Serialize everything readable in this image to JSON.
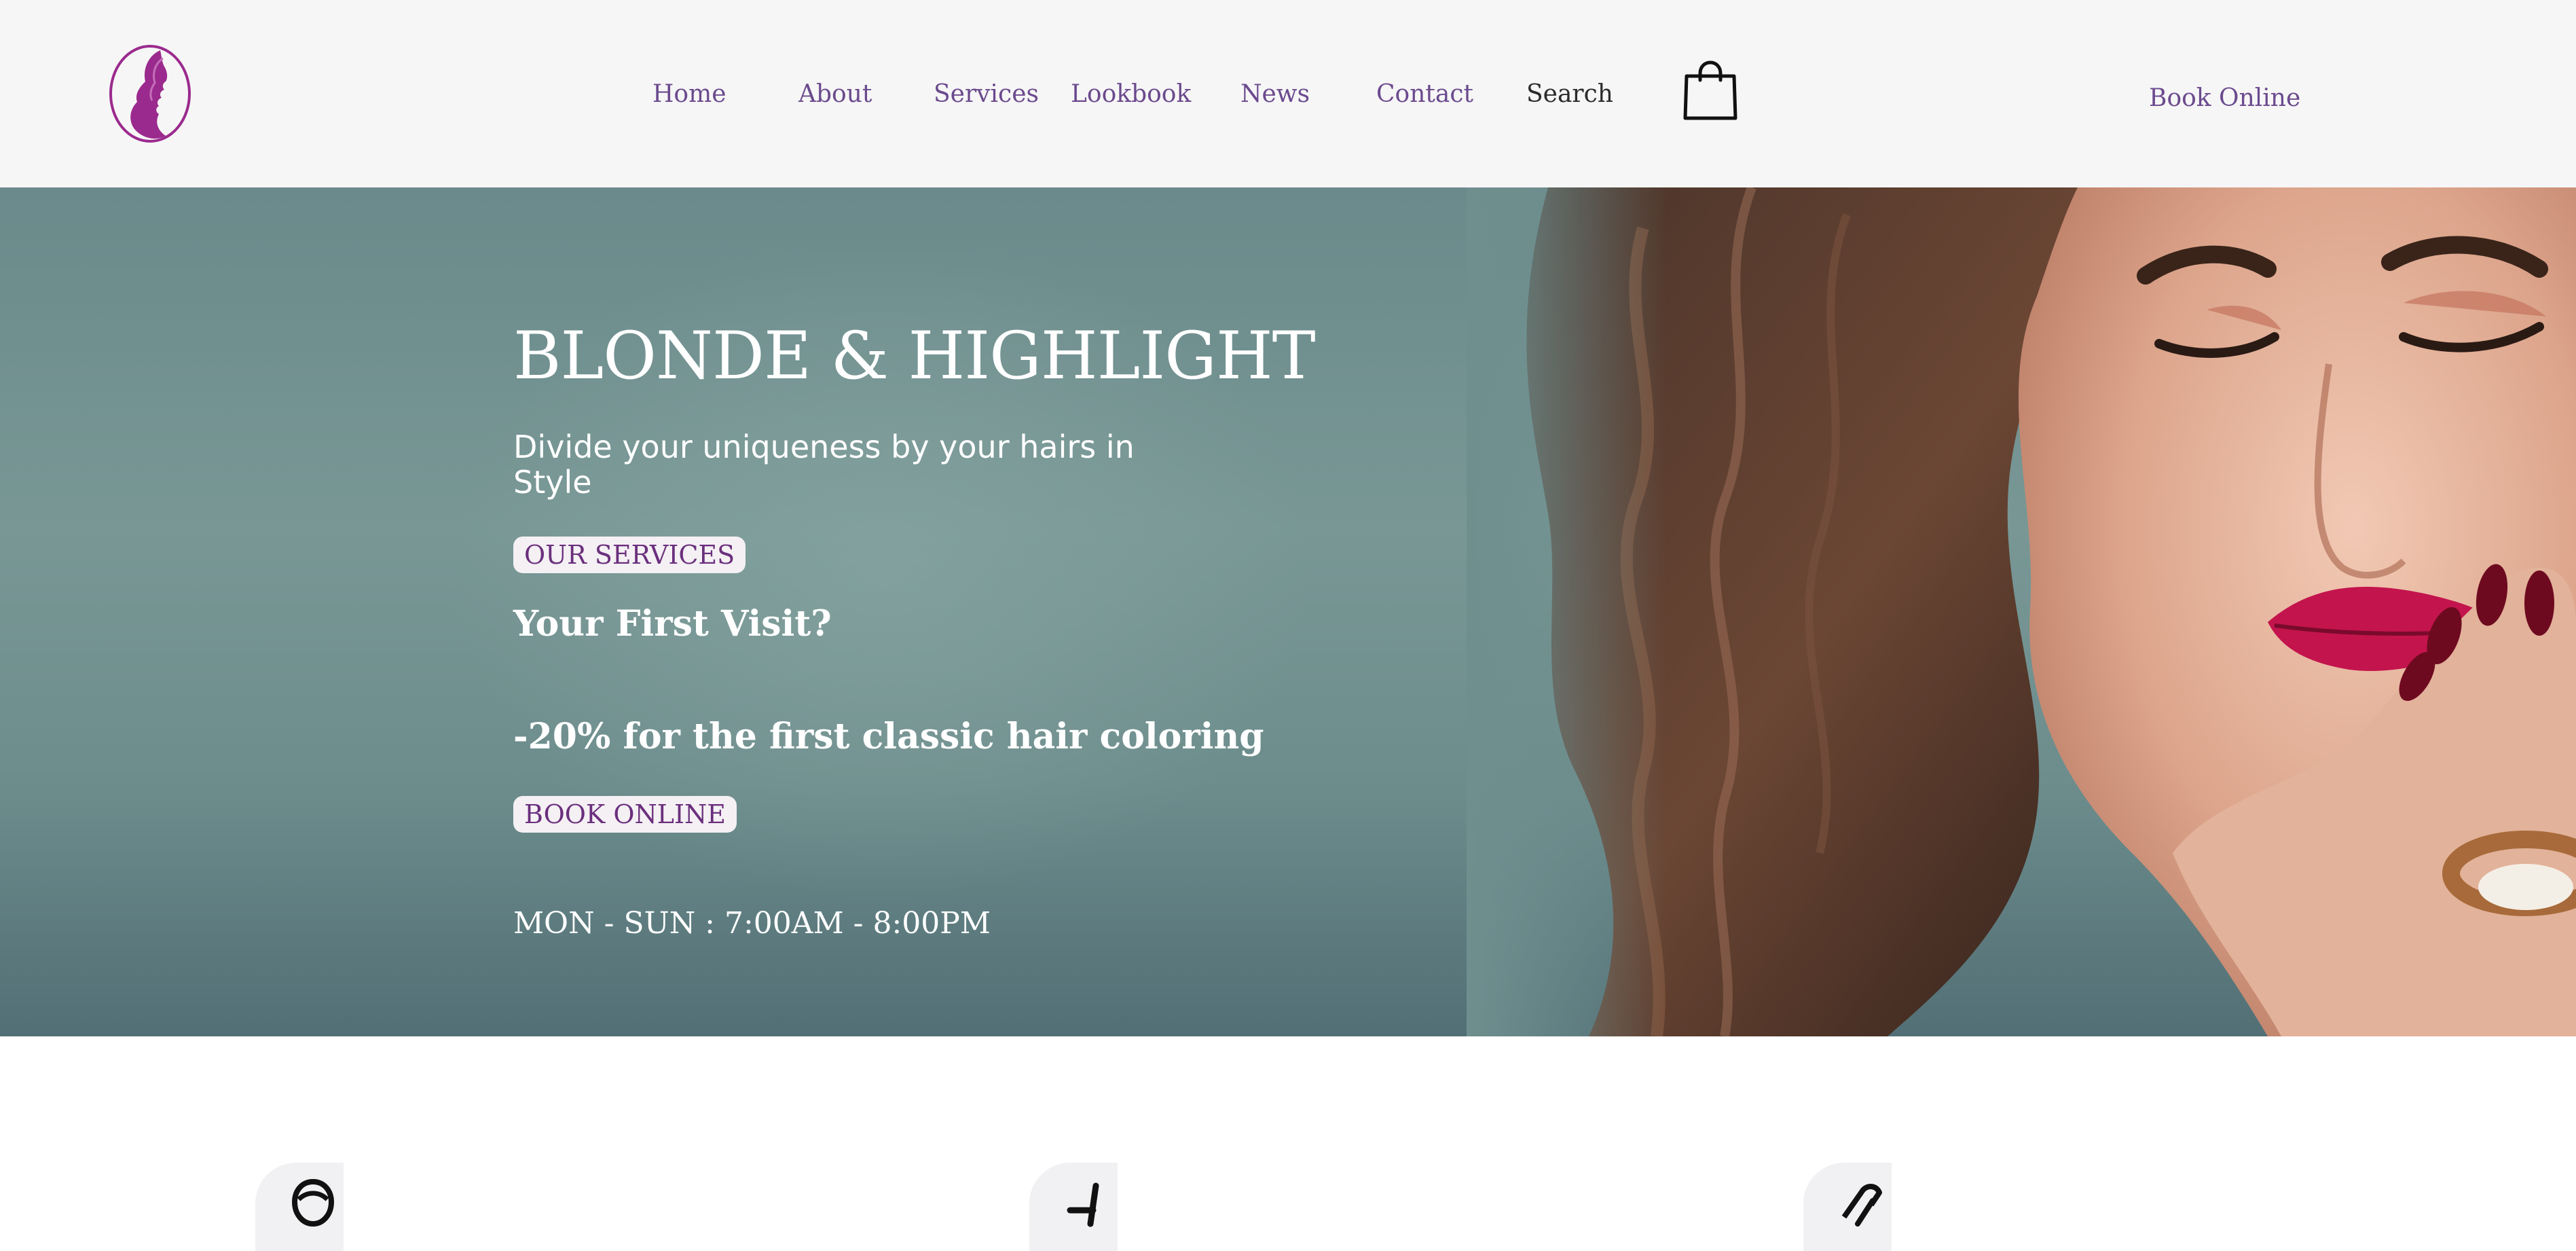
{
  "brand": {
    "logo_icon": "woman-profile-logo",
    "accent_color": "#9b2a8e"
  },
  "nav": {
    "items": [
      {
        "label": "Home"
      },
      {
        "label": "About"
      },
      {
        "label": "Services"
      },
      {
        "label": "Lookbook"
      },
      {
        "label": "News"
      },
      {
        "label": "Contact"
      },
      {
        "label": "Search"
      }
    ],
    "cart_icon": "shopping-bag-icon",
    "book_online_label": "Book Online"
  },
  "hero": {
    "title": "BLONDE & HIGHLIGHT",
    "subtitle": "Divide your uniqueness by your hairs in Style",
    "services_button": "OUR SERVICES",
    "first_visit_heading": "Your First Visit?",
    "offer_heading": "-20% for the first classic hair coloring",
    "book_button": "BOOK ONLINE",
    "hours": "MON - SUN : 7:00AM - 8:00PM",
    "photo": "woman-portrait-photo",
    "background_color": "#6f8f8f"
  },
  "features": [
    {
      "icon": "salon-person-icon"
    },
    {
      "icon": "salon-chair-icon"
    },
    {
      "icon": "hair-dryer-icon"
    }
  ]
}
